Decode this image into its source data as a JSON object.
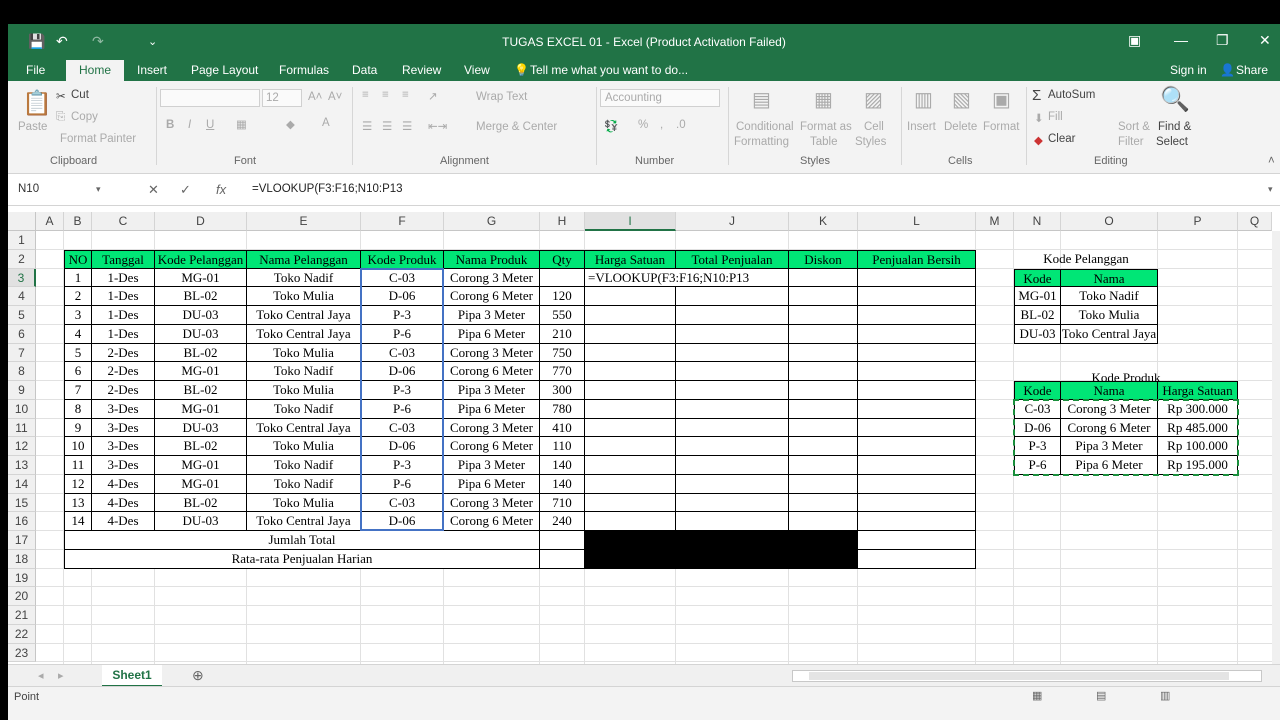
{
  "window": {
    "title": "TUGAS  EXCEL 01 - Excel (Product Activation Failed)",
    "controls": [
      "▣",
      "—",
      "❐",
      "✕"
    ]
  },
  "quick_access": {
    "save": "💾",
    "undo": "↶",
    "redo": "↷",
    "more": "⌄"
  },
  "tabs": {
    "file": "File",
    "home": "Home",
    "insert": "Insert",
    "page_layout": "Page Layout",
    "formulas": "Formulas",
    "data": "Data",
    "review": "Review",
    "view": "View",
    "tell_me": "Tell me what you want to do...",
    "sign_in": "Sign in",
    "share": "Share"
  },
  "ribbon": {
    "clipboard": {
      "paste": "Paste",
      "cut": "Cut",
      "copy": "Copy",
      "format_painter": "Format Painter",
      "group": "Clipboard"
    },
    "font": {
      "size": "12",
      "group": "Font",
      "bold": "B",
      "italic": "I",
      "underline": "U"
    },
    "alignment": {
      "wrap_text": "Wrap Text",
      "merge_center": "Merge & Center",
      "group": "Alignment"
    },
    "number": {
      "format": "Accounting",
      "group": "Number",
      "percent": "%"
    },
    "styles": {
      "conditional": "Conditional",
      "formatting": "Formatting",
      "format_as": "Format as",
      "table": "Table",
      "cell": "Cell",
      "cell_styles": "Styles",
      "group": "Styles"
    },
    "cells": {
      "insert": "Insert",
      "delete": "Delete",
      "format": "Format",
      "group": "Cells"
    },
    "editing": {
      "autosum": "AutoSum",
      "fill": "Fill",
      "clear": "Clear",
      "sort_filter_1": "Sort &",
      "sort_filter_2": "Filter",
      "find_select_1": "Find &",
      "find_select_2": "Select",
      "group": "Editing"
    }
  },
  "formula_bar": {
    "name_box": "N10",
    "fx": "fx",
    "formula": "=VLOOKUP(F3:F16;N10:P13"
  },
  "columns": [
    "A",
    "B",
    "C",
    "D",
    "E",
    "F",
    "G",
    "H",
    "I",
    "J",
    "K",
    "L",
    "M",
    "N",
    "O",
    "P",
    "Q"
  ],
  "rows": [
    "1",
    "2",
    "3",
    "4",
    "5",
    "6",
    "7",
    "8",
    "9",
    "10",
    "11",
    "12",
    "13",
    "14",
    "15",
    "16",
    "17",
    "18",
    "19",
    "20",
    "21",
    "22",
    "23"
  ],
  "main_table": {
    "headers": [
      "NO",
      "Tanggal",
      "Kode Pelanggan",
      "Nama Pelanggan",
      "Kode Produk",
      "Nama Produk",
      "Qty",
      "Harga Satuan",
      "Total Penjualan",
      "Diskon",
      "Penjualan Bersih"
    ],
    "rows": [
      [
        "1",
        "1-Des",
        "MG-01",
        "Toko Nadif",
        "C-03",
        "Corong 3 Meter",
        ""
      ],
      [
        "2",
        "1-Des",
        "BL-02",
        "Toko Mulia",
        "D-06",
        "Corong 6 Meter",
        "120"
      ],
      [
        "3",
        "1-Des",
        "DU-03",
        "Toko Central Jaya",
        "P-3",
        "Pipa 3 Meter",
        "550"
      ],
      [
        "4",
        "1-Des",
        "DU-03",
        "Toko Central Jaya",
        "P-6",
        "Pipa 6 Meter",
        "210"
      ],
      [
        "5",
        "2-Des",
        "BL-02",
        "Toko Mulia",
        "C-03",
        "Corong 3 Meter",
        "750"
      ],
      [
        "6",
        "2-Des",
        "MG-01",
        "Toko Nadif",
        "D-06",
        "Corong 6 Meter",
        "770"
      ],
      [
        "7",
        "2-Des",
        "BL-02",
        "Toko Mulia",
        "P-3",
        "Pipa 3 Meter",
        "300"
      ],
      [
        "8",
        "3-Des",
        "MG-01",
        "Toko Nadif",
        "P-6",
        "Pipa 6 Meter",
        "780"
      ],
      [
        "9",
        "3-Des",
        "DU-03",
        "Toko Central Jaya",
        "C-03",
        "Corong 3 Meter",
        "410"
      ],
      [
        "10",
        "3-Des",
        "BL-02",
        "Toko Mulia",
        "D-06",
        "Corong 6 Meter",
        "110"
      ],
      [
        "11",
        "3-Des",
        "MG-01",
        "Toko Nadif",
        "P-3",
        "Pipa 3 Meter",
        "140"
      ],
      [
        "12",
        "4-Des",
        "MG-01",
        "Toko Nadif",
        "P-6",
        "Pipa 6 Meter",
        "140"
      ],
      [
        "13",
        "4-Des",
        "BL-02",
        "Toko Mulia",
        "C-03",
        "Corong 3 Meter",
        "710"
      ],
      [
        "14",
        "4-Des",
        "DU-03",
        "Toko Central Jaya",
        "D-06",
        "Corong 6 Meter",
        "240"
      ]
    ],
    "editing_cell": "=VLOOKUP(F3:F16;N10:P13",
    "total_label": "Jumlah Total",
    "avg_label": "Rata-rata Penjualan Harian"
  },
  "kode_pelanggan": {
    "title": "Kode Pelanggan",
    "headers": [
      "Kode",
      "Nama"
    ],
    "rows": [
      [
        "MG-01",
        "Toko Nadif"
      ],
      [
        "BL-02",
        "Toko Mulia"
      ],
      [
        "DU-03",
        "Toko Central Jaya"
      ]
    ]
  },
  "kode_produk": {
    "title": "Kode Produk",
    "headers": [
      "Kode",
      "Nama",
      "Harga Satuan"
    ],
    "rows": [
      [
        "C-03",
        "Corong 3 Meter",
        "Rp   300.000"
      ],
      [
        "D-06",
        "Corong 6 Meter",
        "Rp   485.000"
      ],
      [
        "P-3",
        "Pipa 3 Meter",
        "Rp   100.000"
      ],
      [
        "P-6",
        "Pipa 6 Meter",
        "Rp   195.000"
      ]
    ]
  },
  "sheets": {
    "active": "Sheet1",
    "add": "⊕"
  },
  "status": {
    "mode": "Point"
  },
  "colors": {
    "excel_green": "#217346",
    "header_fill": "#00e676",
    "selection_blue": "#4472c4"
  }
}
